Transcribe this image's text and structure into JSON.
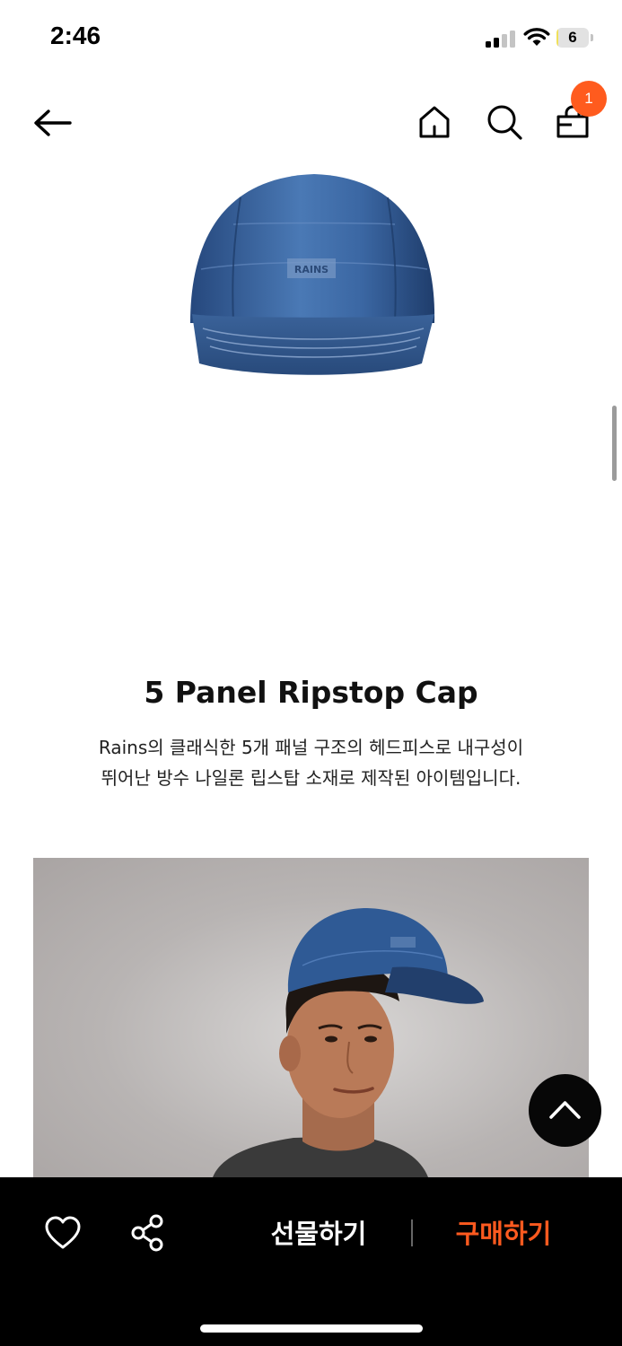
{
  "status_bar": {
    "time": "2:46",
    "battery_level": "6"
  },
  "header": {
    "cart_count": "1",
    "icons": [
      "back-arrow-icon",
      "home-icon",
      "search-icon",
      "shopping-bag-icon"
    ]
  },
  "product": {
    "title": "5 Panel Ripstop Cap",
    "description_line1": "Rains의 클래식한 5개 패널 구조의 헤드피스로 내구성이",
    "description_line2": "뛰어난 방수 나일론 립스탑 소재로 제작된 아이템입니다.",
    "brand_mark": "RAINS"
  },
  "bottom_bar": {
    "gift_label": "선물하기",
    "buy_label": "구매하기",
    "icons": [
      "heart-icon",
      "share-icon"
    ]
  },
  "colors": {
    "accent": "#ff5a1f",
    "badge": "#ff5b1e",
    "bar": "#000000",
    "cap_blue": "#2f5a95"
  }
}
